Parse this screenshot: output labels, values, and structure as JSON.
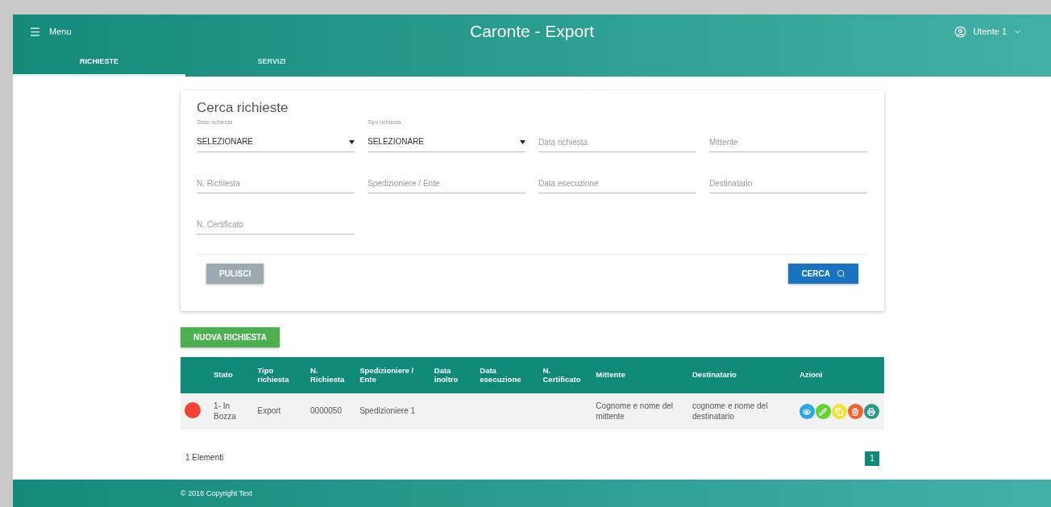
{
  "header": {
    "menu_label": "Menu",
    "title": "Caronte - Export",
    "user": "Utente 1"
  },
  "tabs": [
    {
      "label": "RICHIESTE",
      "selected": true
    },
    {
      "label": "SERVIZI",
      "selected": false
    }
  ],
  "search": {
    "title": "Cerca richieste",
    "fields": [
      {
        "kind": "select",
        "label": "Stato richiesta",
        "value": "SELEZIONARE"
      },
      {
        "kind": "select",
        "label": "Tipo richiesta",
        "value": "SELEZIONARE"
      },
      {
        "kind": "text",
        "placeholder": "Data richiesta"
      },
      {
        "kind": "text",
        "placeholder": "Mittente"
      },
      {
        "kind": "text",
        "placeholder": "N. Richiesta"
      },
      {
        "kind": "text",
        "placeholder": "Spedizioniere / Ente"
      },
      {
        "kind": "text",
        "placeholder": "Data esecuzione"
      },
      {
        "kind": "text",
        "placeholder": "Destinatario"
      },
      {
        "kind": "text",
        "placeholder": "N. Certificato"
      }
    ],
    "clear_button": "PULISCI",
    "search_button": "CERCA"
  },
  "new_button": "NUOVA RICHIESTA",
  "table": {
    "columns": [
      "Stato",
      "Tipo richiesta",
      "N. Richiesta",
      "Spedizioniere / Ente",
      "Data inoltro",
      "Data esecuzione",
      "N. Certificato",
      "Mittente",
      "Destinatario",
      "Azioni"
    ],
    "rows": [
      {
        "color": "#f44336",
        "cells": [
          "1- In Bozza",
          "Export",
          "0000050",
          "Spedizioniere 1",
          "",
          "",
          "",
          "Cognome e nome del mittente",
          "cognome e nome del destinatario"
        ],
        "actions": [
          {
            "kind": "view",
            "color": "#29a9e8"
          },
          {
            "kind": "edit",
            "color": "#5fd52e"
          },
          {
            "kind": "copy",
            "color": "#f2e23a"
          },
          {
            "kind": "delete",
            "color": "#f4632f"
          },
          {
            "kind": "print",
            "color": "#2a9a88"
          }
        ]
      }
    ]
  },
  "count": "1 Elementi",
  "pages": [
    {
      "label": "1",
      "selected": true
    }
  ],
  "footer": "© 2018 Copyright Text"
}
